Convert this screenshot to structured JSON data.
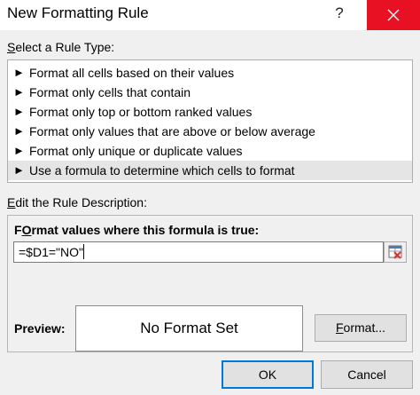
{
  "dialog": {
    "title": "New Formatting Rule",
    "help_label": "?",
    "accent_color": "#0078d7",
    "close_color": "#e81123"
  },
  "rule_type": {
    "label_prefix": "",
    "label_mnemonic": "S",
    "label_rest": "elect a Rule Type:",
    "items": [
      {
        "label": "Format all cells based on their values"
      },
      {
        "label": "Format only cells that contain"
      },
      {
        "label": "Format only top or bottom ranked values"
      },
      {
        "label": "Format only values that are above or below average"
      },
      {
        "label": "Format only unique or duplicate values"
      },
      {
        "label": "Use a formula to determine which cells to format"
      }
    ],
    "selected_index": 5,
    "item_icon": "arrow-right-icon",
    "arrow_glyph": "►"
  },
  "rule_description": {
    "label_mnemonic": "E",
    "label_rest": "dit the Rule Description:",
    "formula_caption_mnemonic": "O",
    "formula_caption_prefix": "F",
    "formula_caption_rest": "rmat values where this formula is true:",
    "formula_value": "=$D1=\"NO\"",
    "collapse_icon": "range-selector-icon",
    "preview_label": "Preview:",
    "preview_text": "No Format Set",
    "format_button_mnemonic": "F",
    "format_button_rest": "ormat..."
  },
  "buttons": {
    "ok": "OK",
    "cancel": "Cancel"
  }
}
